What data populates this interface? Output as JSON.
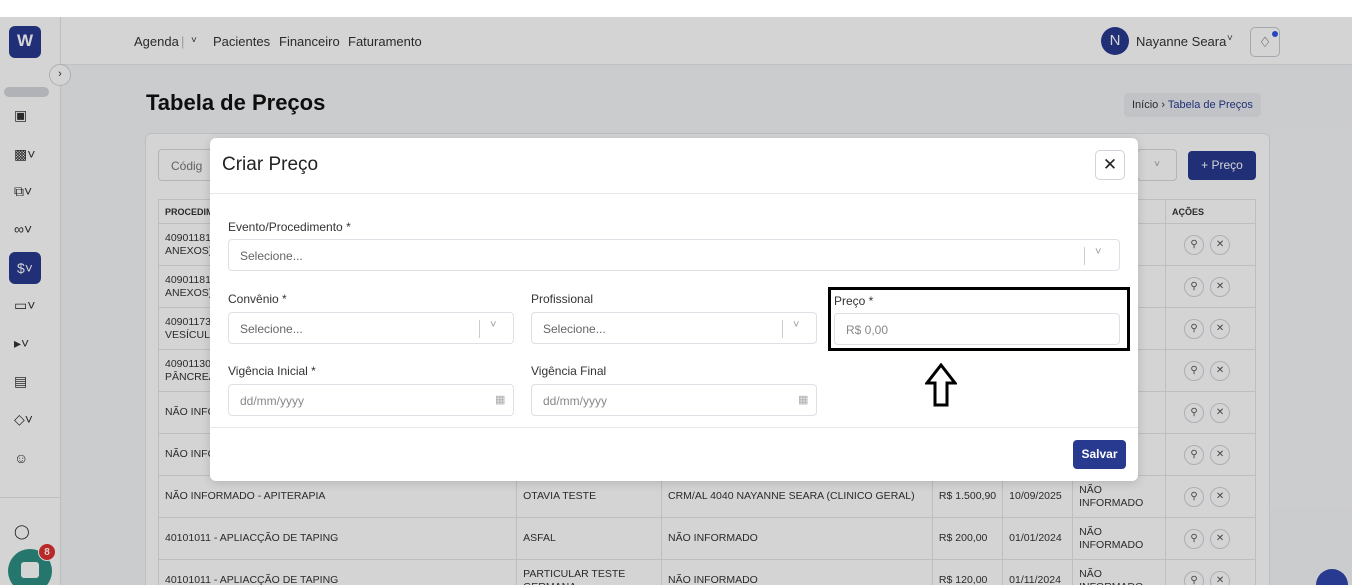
{
  "sidebar": {
    "logo": "W",
    "chat_badge": "8",
    "icons": [
      "dashboard-icon",
      "briefcase-icon",
      "documents-icon",
      "procedures-icon",
      "finance-icon",
      "monitor-icon",
      "megaphone-icon",
      "book-icon",
      "box-icon",
      "users-icon",
      "headset-icon"
    ]
  },
  "topbar": {
    "nav": {
      "agenda": "Agenda",
      "pacientes": "Pacientes",
      "financeiro": "Financeiro",
      "faturamento": "Faturamento"
    },
    "user": {
      "initial": "N",
      "name": "Nayanne Seara"
    }
  },
  "page": {
    "title": "Tabela de Preços",
    "breadcrumb": {
      "home": "Início",
      "current": "Tabela de Preços"
    },
    "search_placeholder": "Códig",
    "add_button": "+ Preço"
  },
  "table": {
    "headers": {
      "procedimento": "PROCEDIM",
      "acoes": "AÇÕES"
    },
    "rows": [
      {
        "procedimento": "40901181\nANEXOS)",
        "convenio": "",
        "profissional": "",
        "preco": "",
        "vig_ini": "",
        "vig_fim": ""
      },
      {
        "procedimento": "40901181\nANEXOS)",
        "convenio": "",
        "profissional": "",
        "preco": "",
        "vig_ini": "",
        "vig_fim": ""
      },
      {
        "procedimento": "40901173\nVESÍCUL",
        "convenio": "",
        "profissional": "",
        "preco": "",
        "vig_ini": "",
        "vig_fim": ""
      },
      {
        "procedimento": "40901130\nPÂNCREA",
        "convenio": "",
        "profissional": "",
        "preco": "",
        "vig_ini": "",
        "vig_fim": ""
      },
      {
        "procedimento": "NÃO INFO",
        "convenio": "",
        "profissional": "",
        "preco": "",
        "vig_ini": "",
        "vig_fim": ""
      },
      {
        "procedimento": "NÃO INFO",
        "convenio": "",
        "profissional": "",
        "preco": "",
        "vig_ini": "",
        "vig_fim": ""
      },
      {
        "procedimento": "NÃO INFORMADO - APITERAPIA",
        "convenio": "OTAVIA TESTE",
        "profissional": "CRM/AL 4040 NAYANNE SEARA (CLINICO GERAL)",
        "preco": "R$ 1.500,90",
        "vig_ini": "10/09/2025",
        "vig_fim": "NÃO\nINFORMADO"
      },
      {
        "procedimento": "40101011 - APLIACÇÃO DE TAPING",
        "convenio": "ASFAL",
        "profissional": "NÃO INFORMADO",
        "preco": "R$ 200,00",
        "vig_ini": "01/01/2024",
        "vig_fim": "NÃO\nINFORMADO"
      },
      {
        "procedimento": "40101011 - APLIACÇÃO DE TAPING",
        "convenio": "PARTICULAR TESTE\nGERMANA",
        "profissional": "NÃO INFORMADO",
        "preco": "R$ 120,00",
        "vig_ini": "01/11/2024",
        "vig_fim": "NÃO\nINFORMADO"
      }
    ]
  },
  "modal": {
    "title": "Criar Preço",
    "fields": {
      "evento_label": "Evento/Procedimento *",
      "evento_placeholder": "Selecione...",
      "convenio_label": "Convênio *",
      "convenio_placeholder": "Selecione...",
      "profissional_label": "Profissional",
      "profissional_placeholder": "Selecione...",
      "preco_label": "Preço *",
      "preco_placeholder": "R$ 0,00",
      "vig_ini_label": "Vigência Inicial *",
      "vig_ini_placeholder": "dd/mm/yyyy",
      "vig_fim_label": "Vigência Final",
      "vig_fim_placeholder": "dd/mm/yyyy"
    },
    "save_button": "Salvar"
  },
  "colors": {
    "primary": "#283a8f",
    "chat": "#2d8f83",
    "badge": "#e03131"
  }
}
